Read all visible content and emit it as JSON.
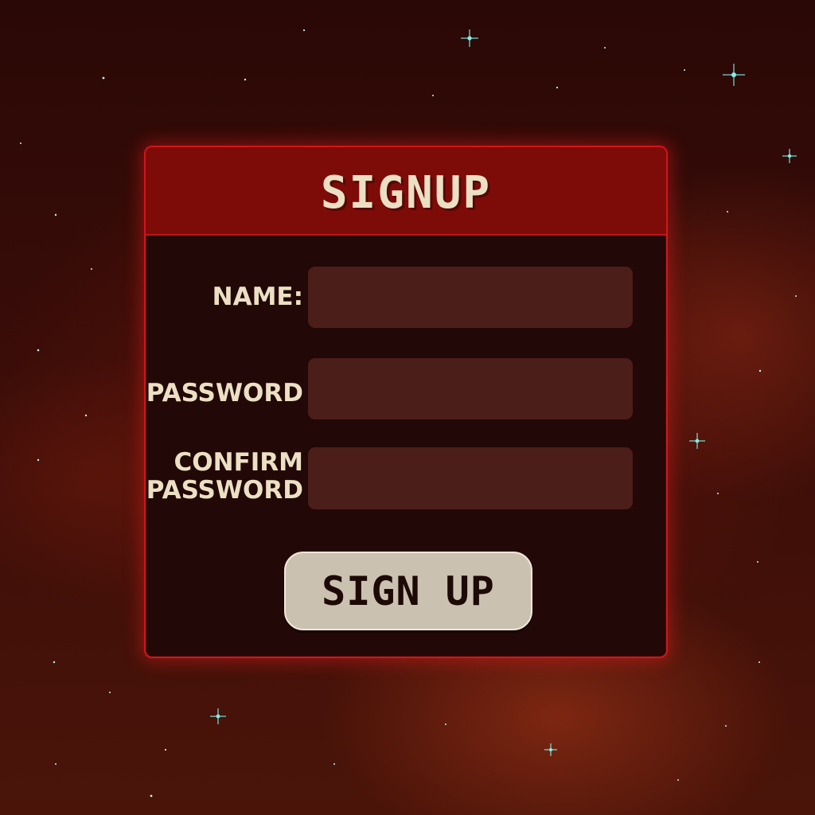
{
  "form": {
    "title": "SIGNUP",
    "fields": [
      {
        "label": "NAME:",
        "value": "",
        "placeholder": ""
      },
      {
        "label": "PASSWORD",
        "value": "",
        "placeholder": ""
      },
      {
        "label_line1": "CONFIRM",
        "label_line2": "PASSWORD",
        "value": "",
        "placeholder": ""
      }
    ],
    "submit_label": "SIGN UP"
  },
  "colors": {
    "background": "#3a0d08",
    "panel_border": "#d4141a",
    "panel_body": "#220806",
    "header": "#7d0c09",
    "input": "#4c1e1a",
    "text": "#ece0c4",
    "button": "#cbc1b1",
    "button_text": "#1d0905",
    "stars": "#7ff0e6"
  }
}
